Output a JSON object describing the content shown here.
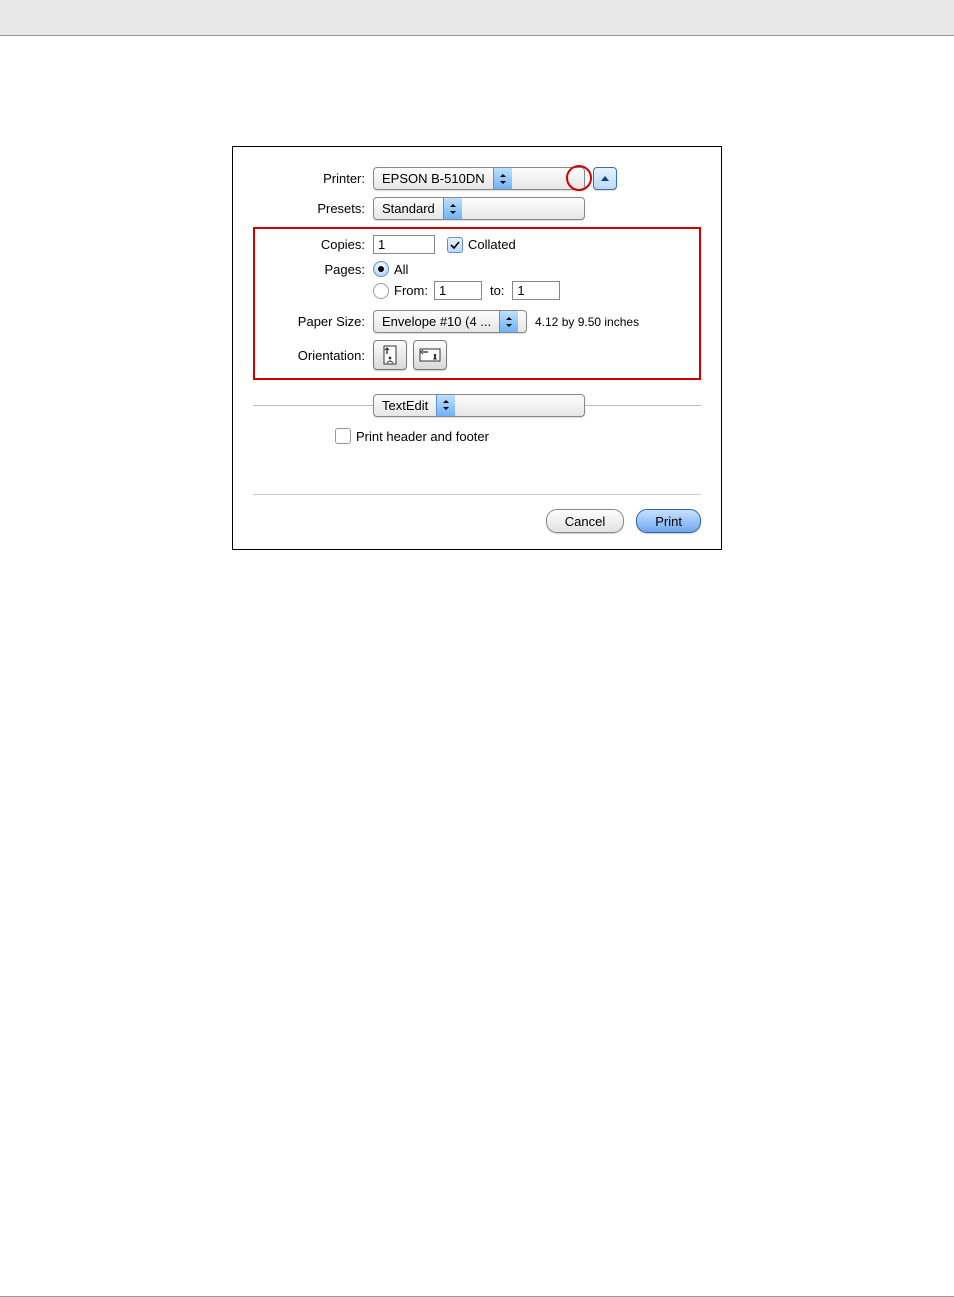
{
  "labels": {
    "printer": "Printer:",
    "presets": "Presets:",
    "copies": "Copies:",
    "pages": "Pages:",
    "paper_size": "Paper Size:",
    "orientation": "Orientation:",
    "from": "From:",
    "to": "to:"
  },
  "printer_value": "EPSON B-510DN",
  "presets_value": "Standard",
  "copies_value": "1",
  "collated_label": "Collated",
  "collated_checked": true,
  "pages_all_label": "All",
  "pages_all_selected": true,
  "pages_from_value": "1",
  "pages_to_value": "1",
  "paper_size_value": "Envelope #10 (4 ...",
  "paper_size_dim": "4.12 by 9.50 inches",
  "section_popup": "TextEdit",
  "print_header_footer_label": "Print header and footer",
  "print_header_footer_checked": false,
  "buttons": {
    "cancel": "Cancel",
    "print": "Print"
  }
}
